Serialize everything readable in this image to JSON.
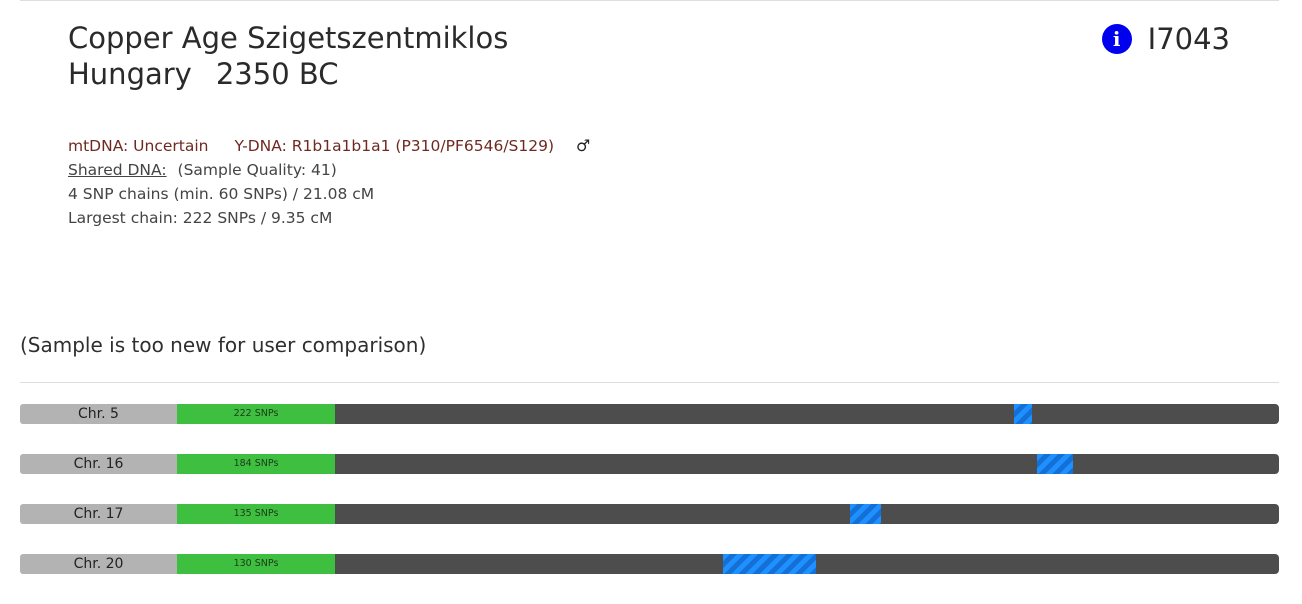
{
  "header": {
    "title_line1": "Copper Age Szigetszentmiklos",
    "country": "Hungary",
    "date": "2350 BC",
    "sample_id": "I7043",
    "info_icon": "info-circle-icon"
  },
  "genetics": {
    "mtdna_label": "mtDNA: Uncertain",
    "ydna_label": "Y-DNA: R1b1a1b1a1 (P310/PF6546/S129)",
    "sex_symbol": "♂",
    "shared_dna_link": "Shared DNA:",
    "sample_quality": "(Sample Quality: 41)",
    "snp_chains": "4 SNP chains (min. 60 SNPs) / 21.08 cM",
    "largest_chain": "Largest chain: 222 SNPs / 9.35 cM"
  },
  "note": "(Sample is too new for user comparison)",
  "colors": {
    "snp_box": "#3fbf3f",
    "track": "#4d4d4d",
    "segment": "#1e90ff",
    "label_bg": "#b3b3b3",
    "haplogroup_text": "#6e2a20",
    "info_icon": "#0000ee"
  },
  "chromosomes": [
    {
      "label": "Chr. 5",
      "snps": "222 SNPs",
      "segment_start": 0.7195,
      "segment_end": 0.7385
    },
    {
      "label": "Chr. 16",
      "snps": "184 SNPs",
      "segment_start": 0.7435,
      "segment_end": 0.7815
    },
    {
      "label": "Chr. 17",
      "snps": "135 SNPs",
      "segment_start": 0.5455,
      "segment_end": 0.5785
    },
    {
      "label": "Chr. 20",
      "snps": "130 SNPs",
      "segment_start": 0.4115,
      "segment_end": 0.51
    }
  ]
}
